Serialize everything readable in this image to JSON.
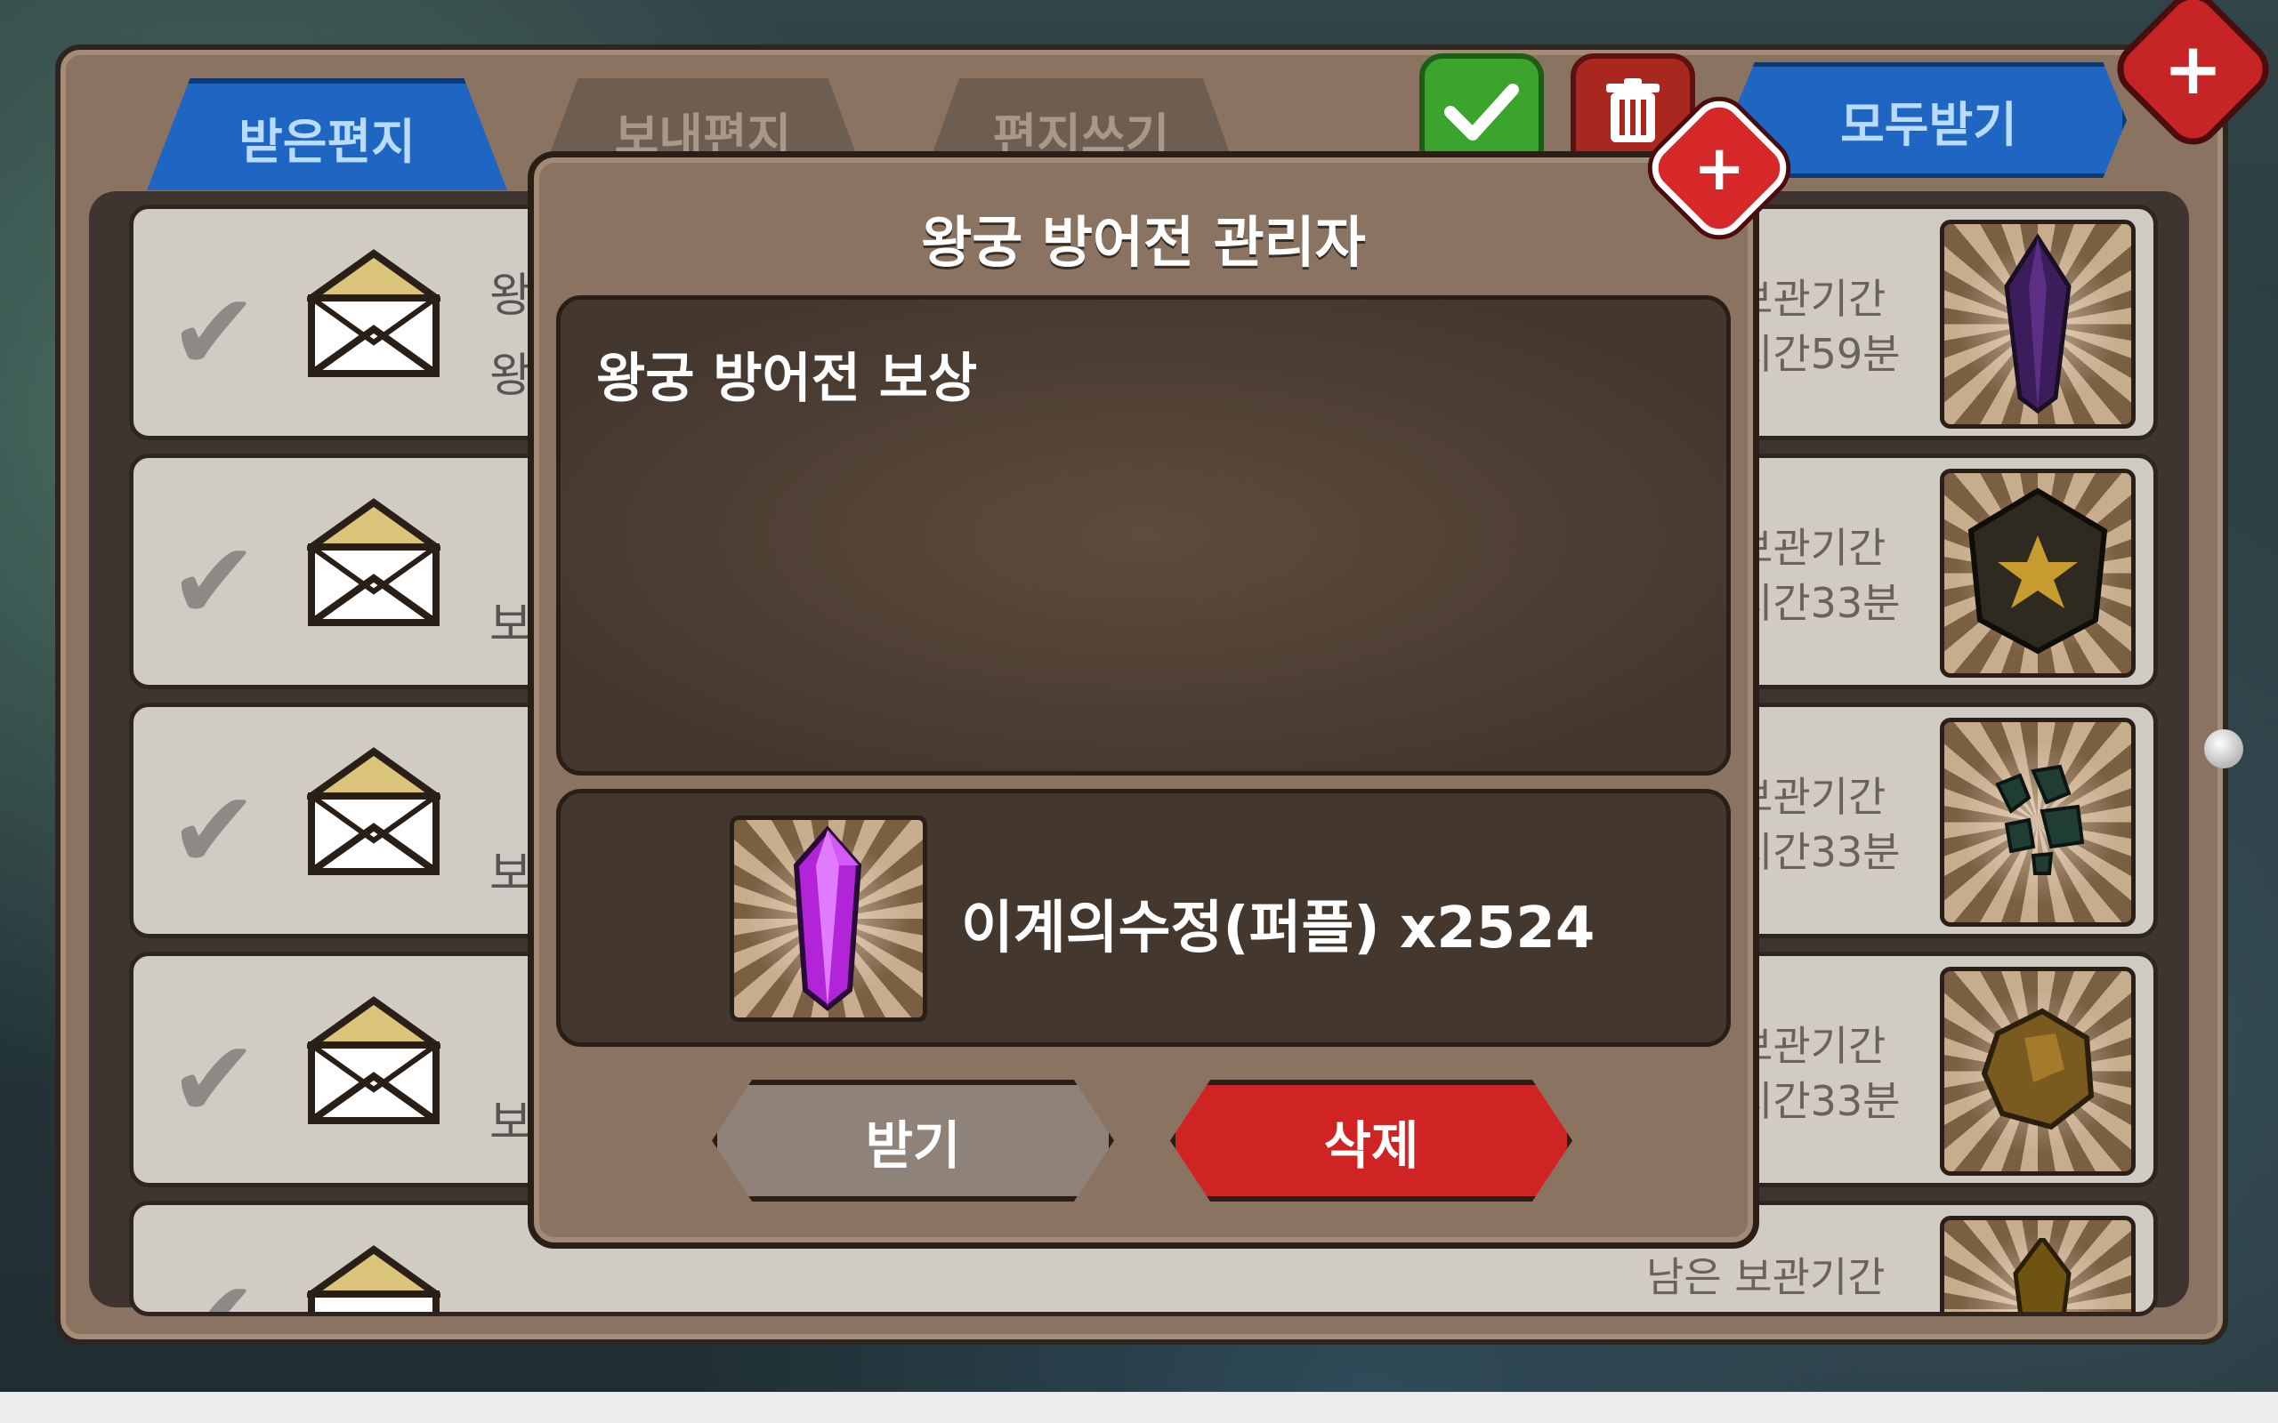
{
  "tabs": {
    "received": "받은편지",
    "sent": "보내편지",
    "write": "편지쓰기"
  },
  "toolbar": {
    "receive_all": "모두받기",
    "check_icon": "check-icon",
    "trash_icon": "trash-icon",
    "close_icon": "close-icon"
  },
  "mail_list": [
    {
      "sender_fragment_1": "왕",
      "sender_fragment_2": "왕",
      "expire_line1": "보관기간",
      "expire_line2": "시간59분",
      "item": "purple-crystal"
    },
    {
      "sender_fragment_1": "",
      "sender_fragment_2": "보",
      "expire_line1": "보관기간",
      "expire_line2": "시간33분",
      "item": "dark-emblem"
    },
    {
      "sender_fragment_1": "",
      "sender_fragment_2": "보",
      "expire_line1": "보관기간",
      "expire_line2": "시간33분",
      "item": "green-ore"
    },
    {
      "sender_fragment_1": "",
      "sender_fragment_2": "보",
      "expire_line1": "보관기간",
      "expire_line2": "시간33분",
      "item": "gold-ore"
    },
    {
      "sender_fragment_1": "",
      "sender_fragment_2": "",
      "expire_line1": "남은 보관기간",
      "expire_line2": "",
      "item": "gold-crystal"
    }
  ],
  "dialog": {
    "title": "왕궁 방어전 관리자",
    "message": "왕궁 방어전 보상",
    "reward_label": "이계의수정(퍼플) x2524",
    "receive_button": "받기",
    "delete_button": "삭제"
  },
  "colors": {
    "accent_blue": "#1f66c2",
    "delete_red": "#d02323",
    "panel_brown": "#8a7360"
  }
}
